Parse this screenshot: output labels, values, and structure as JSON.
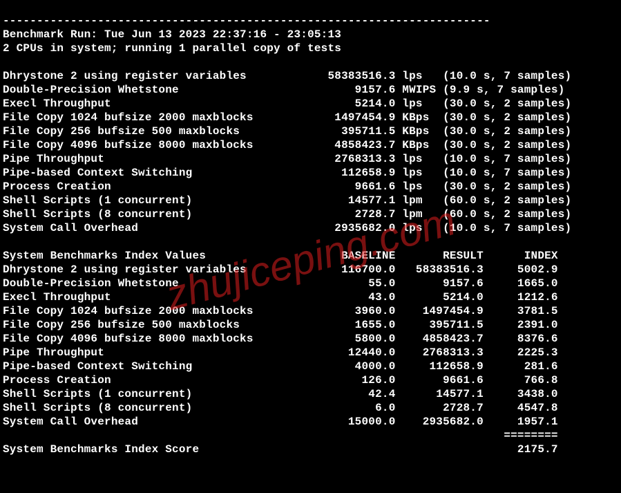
{
  "header_lines": [
    "------------------------------------------------------------------------",
    "Benchmark Run: Tue Jun 13 2023 22:37:16 - 23:05:13",
    "2 CPUs in system; running 1 parallel copy of tests",
    ""
  ],
  "tests": [
    {
      "name": "Dhrystone 2 using register variables",
      "value": "58383516.3",
      "unit": "lps",
      "duration": "10.0",
      "samples": "7"
    },
    {
      "name": "Double-Precision Whetstone",
      "value": "9157.6",
      "unit": "MWIPS",
      "duration": "9.9",
      "samples": "7"
    },
    {
      "name": "Execl Throughput",
      "value": "5214.0",
      "unit": "lps",
      "duration": "30.0",
      "samples": "2"
    },
    {
      "name": "File Copy 1024 bufsize 2000 maxblocks",
      "value": "1497454.9",
      "unit": "KBps",
      "duration": "30.0",
      "samples": "2"
    },
    {
      "name": "File Copy 256 bufsize 500 maxblocks",
      "value": "395711.5",
      "unit": "KBps",
      "duration": "30.0",
      "samples": "2"
    },
    {
      "name": "File Copy 4096 bufsize 8000 maxblocks",
      "value": "4858423.7",
      "unit": "KBps",
      "duration": "30.0",
      "samples": "2"
    },
    {
      "name": "Pipe Throughput",
      "value": "2768313.3",
      "unit": "lps",
      "duration": "10.0",
      "samples": "7"
    },
    {
      "name": "Pipe-based Context Switching",
      "value": "112658.9",
      "unit": "lps",
      "duration": "10.0",
      "samples": "7"
    },
    {
      "name": "Process Creation",
      "value": "9661.6",
      "unit": "lps",
      "duration": "30.0",
      "samples": "2"
    },
    {
      "name": "Shell Scripts (1 concurrent)",
      "value": "14577.1",
      "unit": "lpm",
      "duration": "60.0",
      "samples": "2"
    },
    {
      "name": "Shell Scripts (8 concurrent)",
      "value": "2728.7",
      "unit": "lpm",
      "duration": "60.0",
      "samples": "2"
    },
    {
      "name": "System Call Overhead",
      "value": "2935682.0",
      "unit": "lps",
      "duration": "10.0",
      "samples": "7"
    }
  ],
  "index_header": {
    "title": "System Benchmarks Index Values",
    "col_baseline": "BASELINE",
    "col_result": "RESULT",
    "col_index": "INDEX"
  },
  "index_rows": [
    {
      "name": "Dhrystone 2 using register variables",
      "baseline": "116700.0",
      "result": "58383516.3",
      "index": "5002.9"
    },
    {
      "name": "Double-Precision Whetstone",
      "baseline": "55.0",
      "result": "9157.6",
      "index": "1665.0"
    },
    {
      "name": "Execl Throughput",
      "baseline": "43.0",
      "result": "5214.0",
      "index": "1212.6"
    },
    {
      "name": "File Copy 1024 bufsize 2000 maxblocks",
      "baseline": "3960.0",
      "result": "1497454.9",
      "index": "3781.5"
    },
    {
      "name": "File Copy 256 bufsize 500 maxblocks",
      "baseline": "1655.0",
      "result": "395711.5",
      "index": "2391.0"
    },
    {
      "name": "File Copy 4096 bufsize 8000 maxblocks",
      "baseline": "5800.0",
      "result": "4858423.7",
      "index": "8376.6"
    },
    {
      "name": "Pipe Throughput",
      "baseline": "12440.0",
      "result": "2768313.3",
      "index": "2225.3"
    },
    {
      "name": "Pipe-based Context Switching",
      "baseline": "4000.0",
      "result": "112658.9",
      "index": "281.6"
    },
    {
      "name": "Process Creation",
      "baseline": "126.0",
      "result": "9661.6",
      "index": "766.8"
    },
    {
      "name": "Shell Scripts (1 concurrent)",
      "baseline": "42.4",
      "result": "14577.1",
      "index": "3438.0"
    },
    {
      "name": "Shell Scripts (8 concurrent)",
      "baseline": "6.0",
      "result": "2728.7",
      "index": "4547.8"
    },
    {
      "name": "System Call Overhead",
      "baseline": "15000.0",
      "result": "2935682.0",
      "index": "1957.1"
    }
  ],
  "score_line": {
    "label": "System Benchmarks Index Score",
    "value": "2175.7",
    "rule": "========"
  },
  "watermark": "zhujiceping.com"
}
